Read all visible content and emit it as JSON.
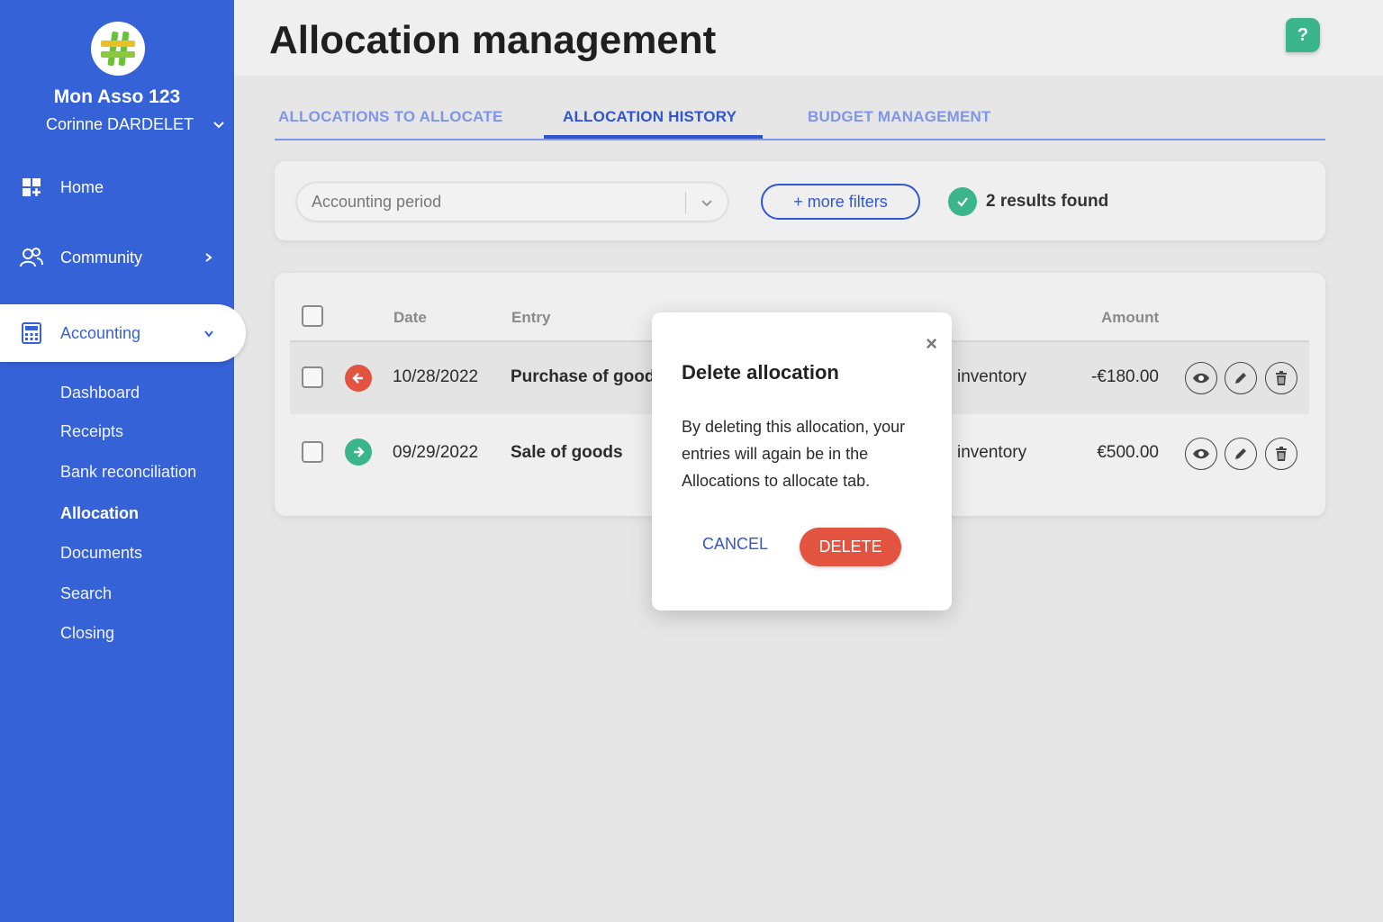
{
  "sidebar": {
    "org_name": "Mon Asso 123",
    "user_name": "Corinne DARDELET",
    "nav": [
      {
        "label": "Home",
        "icon": "home-grid-icon"
      },
      {
        "label": "Community",
        "icon": "community-icon"
      },
      {
        "label": "Accounting",
        "icon": "calculator-icon"
      }
    ],
    "sub_items": [
      "Dashboard",
      "Receipts",
      "Bank reconciliation",
      "Allocation",
      "Documents",
      "Search",
      "Closing"
    ],
    "current_sub_item": "Allocation"
  },
  "header": {
    "title": "Allocation management",
    "help_label": "?"
  },
  "tabs": [
    {
      "label": "ALLOCATIONS TO ALLOCATE"
    },
    {
      "label": "ALLOCATION HISTORY",
      "active": true
    },
    {
      "label": "BUDGET MANAGEMENT"
    }
  ],
  "filters": {
    "period_placeholder": "Accounting period",
    "more_filters_label": "+ more filters",
    "results_text": "2 results found"
  },
  "table": {
    "columns": {
      "date": "Date",
      "entry": "Entry",
      "amount": "Amount"
    },
    "rows": [
      {
        "direction": "out",
        "date": "10/28/2022",
        "entry": "Purchase of goods",
        "allocation": "inventory",
        "amount": "-€180.00"
      },
      {
        "direction": "in",
        "date": "09/29/2022",
        "entry": "Sale of goods",
        "allocation": "inventory",
        "amount": "€500.00"
      }
    ]
  },
  "modal": {
    "close_label": "×",
    "title": "Delete allocation",
    "body": "By deleting this allocation, your entries will again be in the Allocations to allocate tab.",
    "cancel_label": "CANCEL",
    "delete_label": "DELETE"
  },
  "colors": {
    "sidebar": "#3662d8",
    "primary": "#2f55cf",
    "success": "#3bb58c",
    "danger": "#e2543f"
  }
}
